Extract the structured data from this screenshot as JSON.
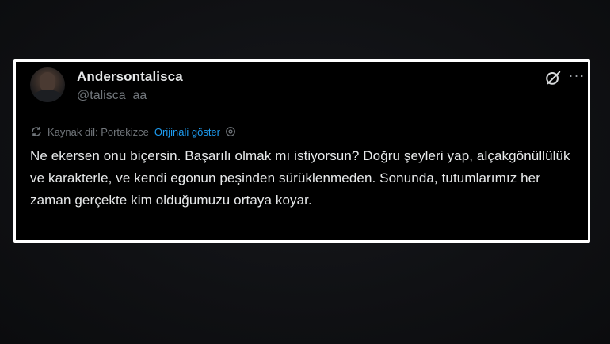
{
  "tweet": {
    "display_name": "Andersontalisca",
    "handle": "@talisca_aa",
    "translation_label": "Kaynak dil: Portekizce",
    "show_original_label": "Orijinali göster",
    "body": "Ne ekersen onu biçersin. Başarılı olmak mı istiyorsun? Doğru şeyleri yap, alçakgönüllülük ve karakterle, ve kendi egonun peşinden sürüklenmeden. Sonunda, tutumlarımız her zaman gerçekte kim olduğumuzu ortaya koyar.",
    "more_icon_glyph": "···"
  },
  "icons": {
    "translate": "translate-icon",
    "grok": "grok-icon",
    "more": "more-options-icon",
    "settings": "settings-gear-icon"
  },
  "colors": {
    "card_background": "#000000",
    "card_border": "#ffffff",
    "text_primary": "#e7e9ea",
    "text_secondary": "#71767b",
    "link": "#1d9bf0",
    "page_background": "#0f1013"
  }
}
